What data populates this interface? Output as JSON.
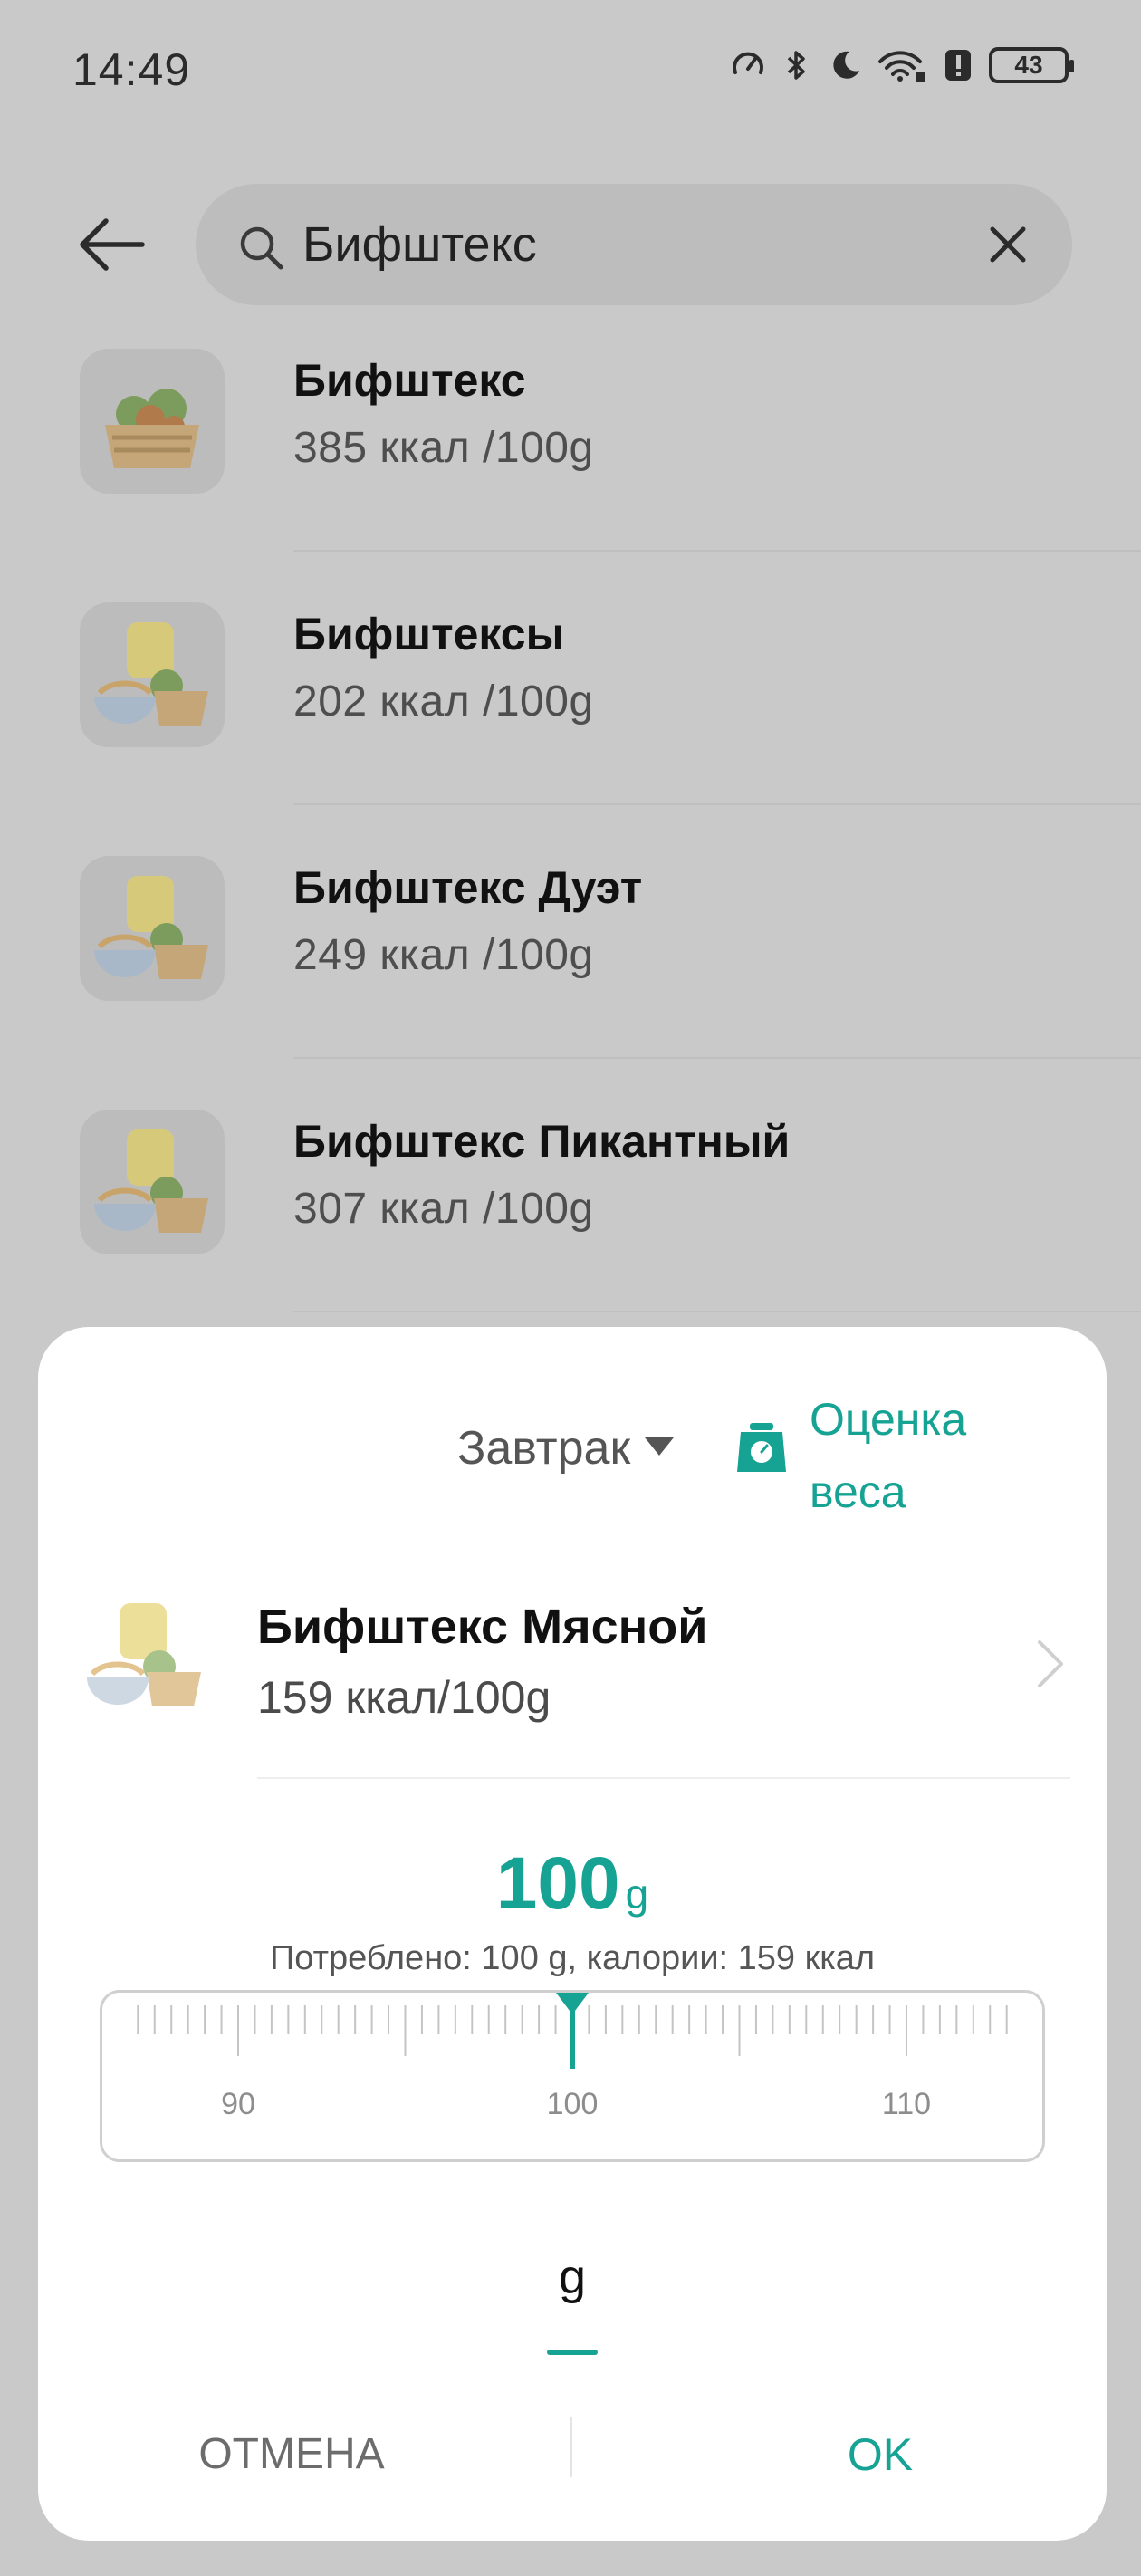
{
  "status_bar": {
    "time": "14:49",
    "battery": "43",
    "icons": [
      "speed-icon",
      "bluetooth-icon",
      "moon-icon",
      "wifi-icon",
      "alert-icon",
      "battery-icon"
    ]
  },
  "search": {
    "query": "Бифштекс",
    "back_icon": "arrow-left-icon",
    "search_icon": "search-icon",
    "clear_icon": "close-icon"
  },
  "results": [
    {
      "name": "Бифштекс",
      "kcal": "385 ккал  /100g",
      "icon": "food-basket-icon"
    },
    {
      "name": "Бифштексы",
      "kcal": "202 ккал  /100g",
      "icon": "food-mix-icon"
    },
    {
      "name": "Бифштекс Дуэт",
      "kcal": "249 ккал  /100g",
      "icon": "food-mix-icon"
    },
    {
      "name": "Бифштекс Пикантный",
      "kcal": "307 ккал  /100g",
      "icon": "food-mix-icon"
    }
  ],
  "sheet": {
    "meal": "Завтрак",
    "weight_estimate": "Оценка веса",
    "product": {
      "name": "Бифштекс Мясной",
      "kcal": "159 ккал/100g"
    },
    "amount": {
      "value": "100",
      "unit": "g",
      "consumed_text": "Потреблено: 100 g, калории: 159 ккал"
    },
    "ruler": {
      "labels": [
        "90",
        "100",
        "110"
      ],
      "min": 90,
      "max": 110,
      "selected": 100
    },
    "unit_tab": "g",
    "cancel": "ОТМЕНА",
    "ok": "OK"
  },
  "colors": {
    "accent": "#16a394",
    "overlay_background": "#c9c9c9",
    "sheet_background": "#ffffff"
  }
}
